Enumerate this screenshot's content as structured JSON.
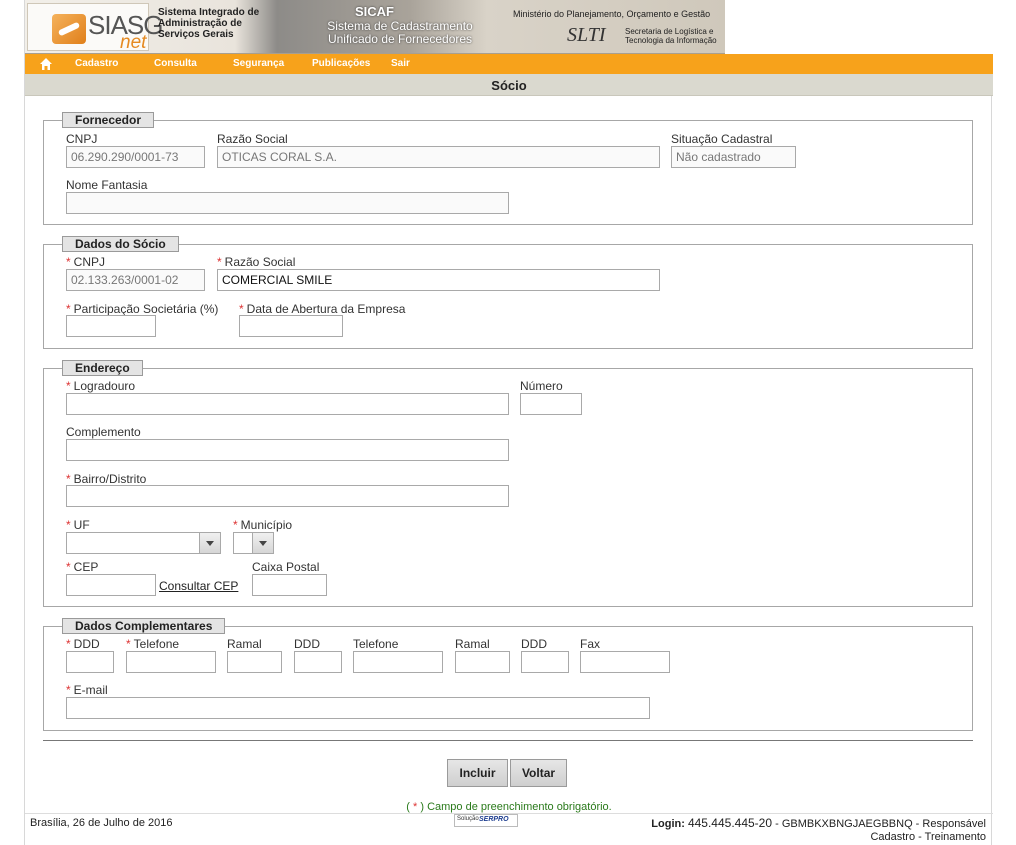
{
  "header": {
    "logo_text": "SIASG",
    "logo_net": "net",
    "siasg_desc_1": "Sistema Integrado de",
    "siasg_desc_2": "Administração de",
    "siasg_desc_3": "Serviços Gerais",
    "sicaf_title": "SICAF",
    "sicaf_sub_1": "Sistema de Cadastramento",
    "sicaf_sub_2": "Unificado de Fornecedores",
    "ministry": "Ministério do Planejamento, Orçamento e Gestão",
    "slti": "SLTI",
    "slti_desc_1": "Secretaria de Logística e",
    "slti_desc_2": "Tecnologia da Informação"
  },
  "menu": {
    "home_icon": "home-icon",
    "items": [
      "Cadastro",
      "Consulta",
      "Segurança",
      "Publicações",
      "Sair"
    ]
  },
  "page_title": "Sócio",
  "fornecedor": {
    "legend": "Fornecedor",
    "cnpj_label": "CNPJ",
    "cnpj_value": "06.290.290/0001-73",
    "razao_label": "Razão Social",
    "razao_value": "OTICAS CORAL S.A.",
    "situacao_label": "Situação Cadastral",
    "situacao_value": "Não cadastrado",
    "fantasia_label": "Nome Fantasia",
    "fantasia_value": ""
  },
  "socio": {
    "legend": "Dados do Sócio",
    "cnpj_label": "CNPJ",
    "cnpj_value": "02.133.263/0001-02",
    "razao_label": "Razão Social",
    "razao_value": "COMERCIAL SMILE",
    "participacao_label": "Participação Societária (%)",
    "participacao_value": "",
    "abertura_label": "Data de Abertura da Empresa",
    "abertura_value": ""
  },
  "endereco": {
    "legend": "Endereço",
    "logradouro_label": "Logradouro",
    "numero_label": "Número",
    "complemento_label": "Complemento",
    "bairro_label": "Bairro/Distrito",
    "uf_label": "UF",
    "municipio_label": "Município",
    "cep_label": "CEP",
    "consultar_cep": "Consultar CEP",
    "caixa_postal_label": "Caixa Postal"
  },
  "complementares": {
    "legend": "Dados Complementares",
    "ddd1_label": "DDD",
    "tel1_label": "Telefone",
    "ramal1_label": "Ramal",
    "ddd2_label": "DDD",
    "tel2_label": "Telefone",
    "ramal2_label": "Ramal",
    "ddd3_label": "DDD",
    "fax_label": "Fax",
    "email_label": "E-mail"
  },
  "required_mark": "*",
  "buttons": {
    "incluir": "Incluir",
    "voltar": "Voltar"
  },
  "required_note": {
    "open": "(",
    "star": "*",
    "rest": ") Campo de preenchimento obrigatório."
  },
  "footer": {
    "date": "Brasília, 26 de Julho de 2016",
    "serpro_a": "Solução",
    "serpro_b": "SERPRO",
    "login_label": "Login:",
    "login_value": "445.445.445-20",
    "login_info": "- GBMBKXBNGJAEGBBNQ - Responsável",
    "login_info_2": "Cadastro - Treinamento"
  },
  "colors": {
    "menu_orange": "#f7a21b",
    "title_bar": "#dad9cf",
    "required_red": "#d33333",
    "note_green": "#2a7a1b"
  }
}
